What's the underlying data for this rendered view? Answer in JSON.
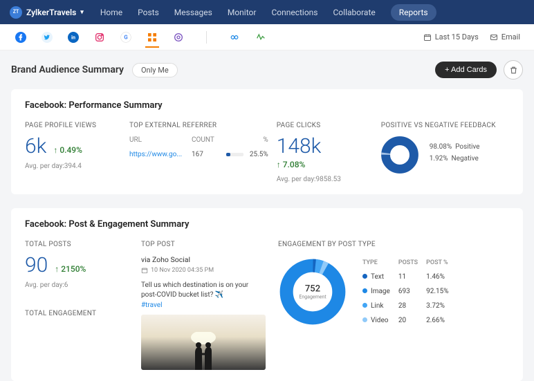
{
  "brand": "ZylkerTravels",
  "nav": [
    "Home",
    "Posts",
    "Messages",
    "Monitor",
    "Connections",
    "Collaborate",
    "Reports"
  ],
  "nav_active": 6,
  "toolbar": {
    "range": "Last 15 Days",
    "email": "Email"
  },
  "page": {
    "title": "Brand Audience Summary",
    "chip": "Only Me",
    "add": "+ Add Cards"
  },
  "perf": {
    "title": "Facebook: Performance Summary",
    "views": {
      "label": "PAGE PROFILE VIEWS",
      "value": "6k",
      "delta": "0.49%",
      "dir": "up",
      "avg": "Avg. per day:394.4"
    },
    "ref": {
      "label": "TOP EXTERNAL REFERRER",
      "h1": "URL",
      "h2": "COUNT",
      "h3": "%",
      "url": "https://www.go...",
      "count": "167",
      "pct": "25.5%",
      "pct_num": 25.5
    },
    "clicks": {
      "label": "PAGE CLICKS",
      "value": "148k",
      "delta": "7.08%",
      "dir": "up",
      "avg": "Avg. per day:9858.53"
    },
    "feedback": {
      "label": "POSITIVE VS NEGATIVE FEEDBACK",
      "pos_pct": "98.08%",
      "pos_lbl": "Positive",
      "neg_pct": "1.92%",
      "neg_lbl": "Negative"
    }
  },
  "post": {
    "title": "Facebook: Post & Engagement Summary",
    "total": {
      "label": "TOTAL POSTS",
      "value": "90",
      "delta": "2150%",
      "dir": "up",
      "avg": "Avg. per day:6"
    },
    "eng_label": "TOTAL ENGAGEMENT",
    "top": {
      "label": "TOP POST",
      "src": "via Zoho Social",
      "date": "10 Nov 2020 04:35 PM",
      "caption": "Tell us which destination is on your post-COVID bucket list? ✈️",
      "hashtag": "#travel"
    },
    "ebt": {
      "label": "ENGAGEMENT BY POST TYPE",
      "center_n": "752",
      "center_l": "Engagement",
      "th1": "TYPE",
      "th2": "POSTS",
      "th3": "POST %",
      "rows": [
        {
          "color": "#1565c0",
          "type": "Text",
          "posts": "11",
          "pct": "1.46%"
        },
        {
          "color": "#1e88e5",
          "type": "Image",
          "posts": "693",
          "pct": "92.15%"
        },
        {
          "color": "#42a5f5",
          "type": "Link",
          "posts": "28",
          "pct": "3.72%"
        },
        {
          "color": "#90caf9",
          "type": "Video",
          "posts": "20",
          "pct": "2.66%"
        }
      ]
    }
  },
  "chart_data": [
    {
      "type": "pie",
      "title": "Positive vs Negative Feedback",
      "categories": [
        "Positive",
        "Negative"
      ],
      "values": [
        98.08,
        1.92
      ]
    },
    {
      "type": "bar",
      "title": "Top External Referrer",
      "categories": [
        "https://www.go..."
      ],
      "values": [
        25.5
      ],
      "ylabel": "%",
      "ylim": [
        0,
        100
      ]
    },
    {
      "type": "pie",
      "title": "Engagement by Post Type",
      "categories": [
        "Text",
        "Image",
        "Link",
        "Video"
      ],
      "values": [
        1.46,
        92.15,
        3.72,
        2.66
      ],
      "annotations": [
        "752 Engagement"
      ]
    }
  ]
}
